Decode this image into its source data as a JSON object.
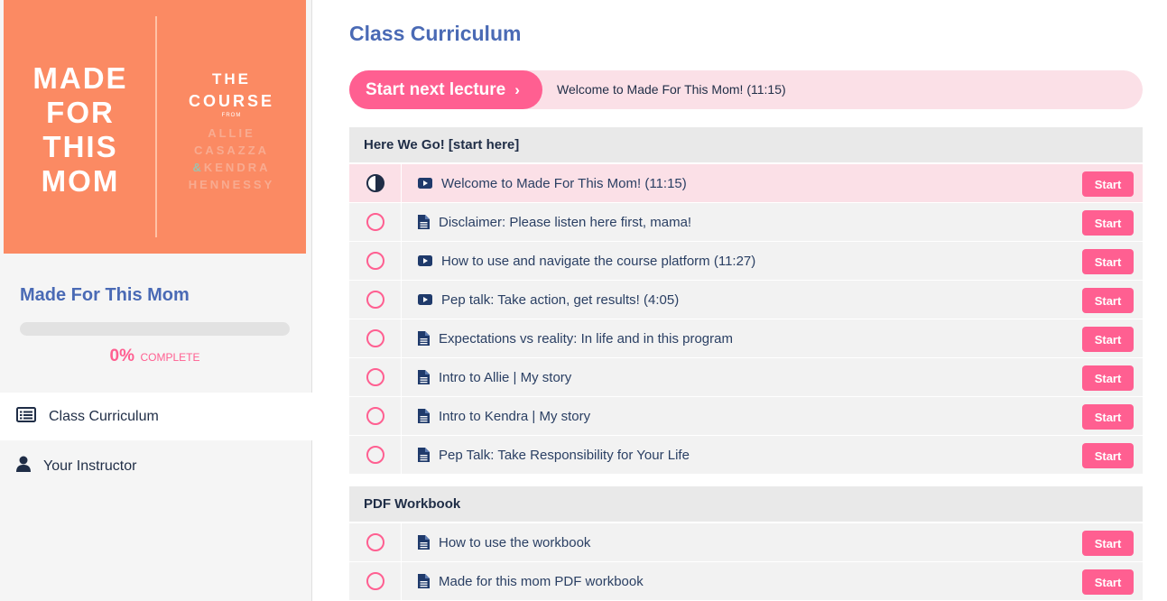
{
  "sidebar": {
    "cover": {
      "title_lines": [
        "MADE",
        "FOR",
        "THIS",
        "MOM"
      ],
      "the": "THE",
      "course": "COURSE",
      "from": "FROM",
      "name1": "ALLIE",
      "name2": "CASAZZA",
      "amp": "&",
      "name3": "KENDRA",
      "name4": "HENNESSY"
    },
    "course_name": "Made For This Mom",
    "progress": {
      "fraction": 0,
      "percent_label": "0%",
      "complete_word": "COMPLETE"
    },
    "nav": [
      {
        "label": "Class Curriculum",
        "icon": "list-icon",
        "active": true
      },
      {
        "label": "Your Instructor",
        "icon": "user-icon",
        "active": false
      }
    ]
  },
  "main": {
    "title": "Class Curriculum",
    "next_lecture": {
      "button_label": "Start next lecture",
      "chevron": "›",
      "lecture": "Welcome to Made For This Mom! (11:15)"
    },
    "sections": [
      {
        "title": "Here We Go! [start here]",
        "lectures": [
          {
            "title": "Welcome to Made For This Mom! (11:15)",
            "type": "video-icon",
            "status": "in-progress",
            "button": "Start"
          },
          {
            "title": "Disclaimer: Please listen here first, mama!",
            "type": "document-icon",
            "status": "not-started",
            "button": "Start"
          },
          {
            "title": "How to use and navigate the course platform (11:27)",
            "type": "video-icon",
            "status": "not-started",
            "button": "Start"
          },
          {
            "title": "Pep talk: Take action, get results! (4:05)",
            "type": "video-icon",
            "status": "not-started",
            "button": "Start"
          },
          {
            "title": "Expectations vs reality: In life and in this program",
            "type": "document-icon",
            "status": "not-started",
            "button": "Start"
          },
          {
            "title": "Intro to Allie | My story",
            "type": "document-icon",
            "status": "not-started",
            "button": "Start"
          },
          {
            "title": "Intro to Kendra | My story",
            "type": "document-icon",
            "status": "not-started",
            "button": "Start"
          },
          {
            "title": "Pep Talk: Take Responsibility for Your Life",
            "type": "document-icon",
            "status": "not-started",
            "button": "Start"
          }
        ]
      },
      {
        "title": "PDF Workbook",
        "lectures": [
          {
            "title": "How to use the workbook",
            "type": "document-icon",
            "status": "not-started",
            "button": "Start"
          },
          {
            "title": "Made for this mom PDF workbook",
            "type": "document-icon",
            "status": "not-started",
            "button": "Start"
          }
        ]
      }
    ]
  },
  "colors": {
    "accent": "#ff5f91",
    "heading": "#4a6ab5",
    "text": "#1f2d46",
    "cover": "#fb8a63",
    "highlight": "#fbe0e7"
  }
}
